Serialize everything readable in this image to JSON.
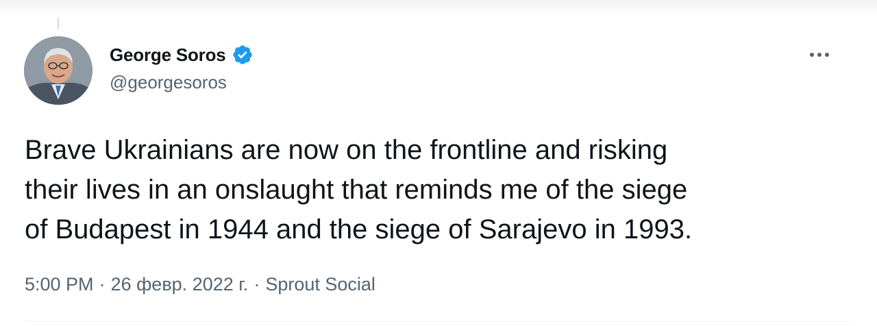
{
  "tweet": {
    "display_name": "George Soros",
    "handle": "@georgesoros",
    "text": "Brave Ukrainians are now on the frontline and risking\ntheir lives in an onslaught that reminds me of the siege\nof Budapest in 1944 and the siege of Sarajevo in 1993.",
    "time": "5:00 PM",
    "separator": "·",
    "date": "26 февр. 2022 г.",
    "source": "Sprout Social"
  },
  "icons": {
    "verified": "verified-badge-icon",
    "more": "more-options-icon"
  },
  "colors": {
    "verified_blue": "#1d9bf0",
    "secondary_text": "#536471",
    "primary_text": "#0f1419"
  }
}
